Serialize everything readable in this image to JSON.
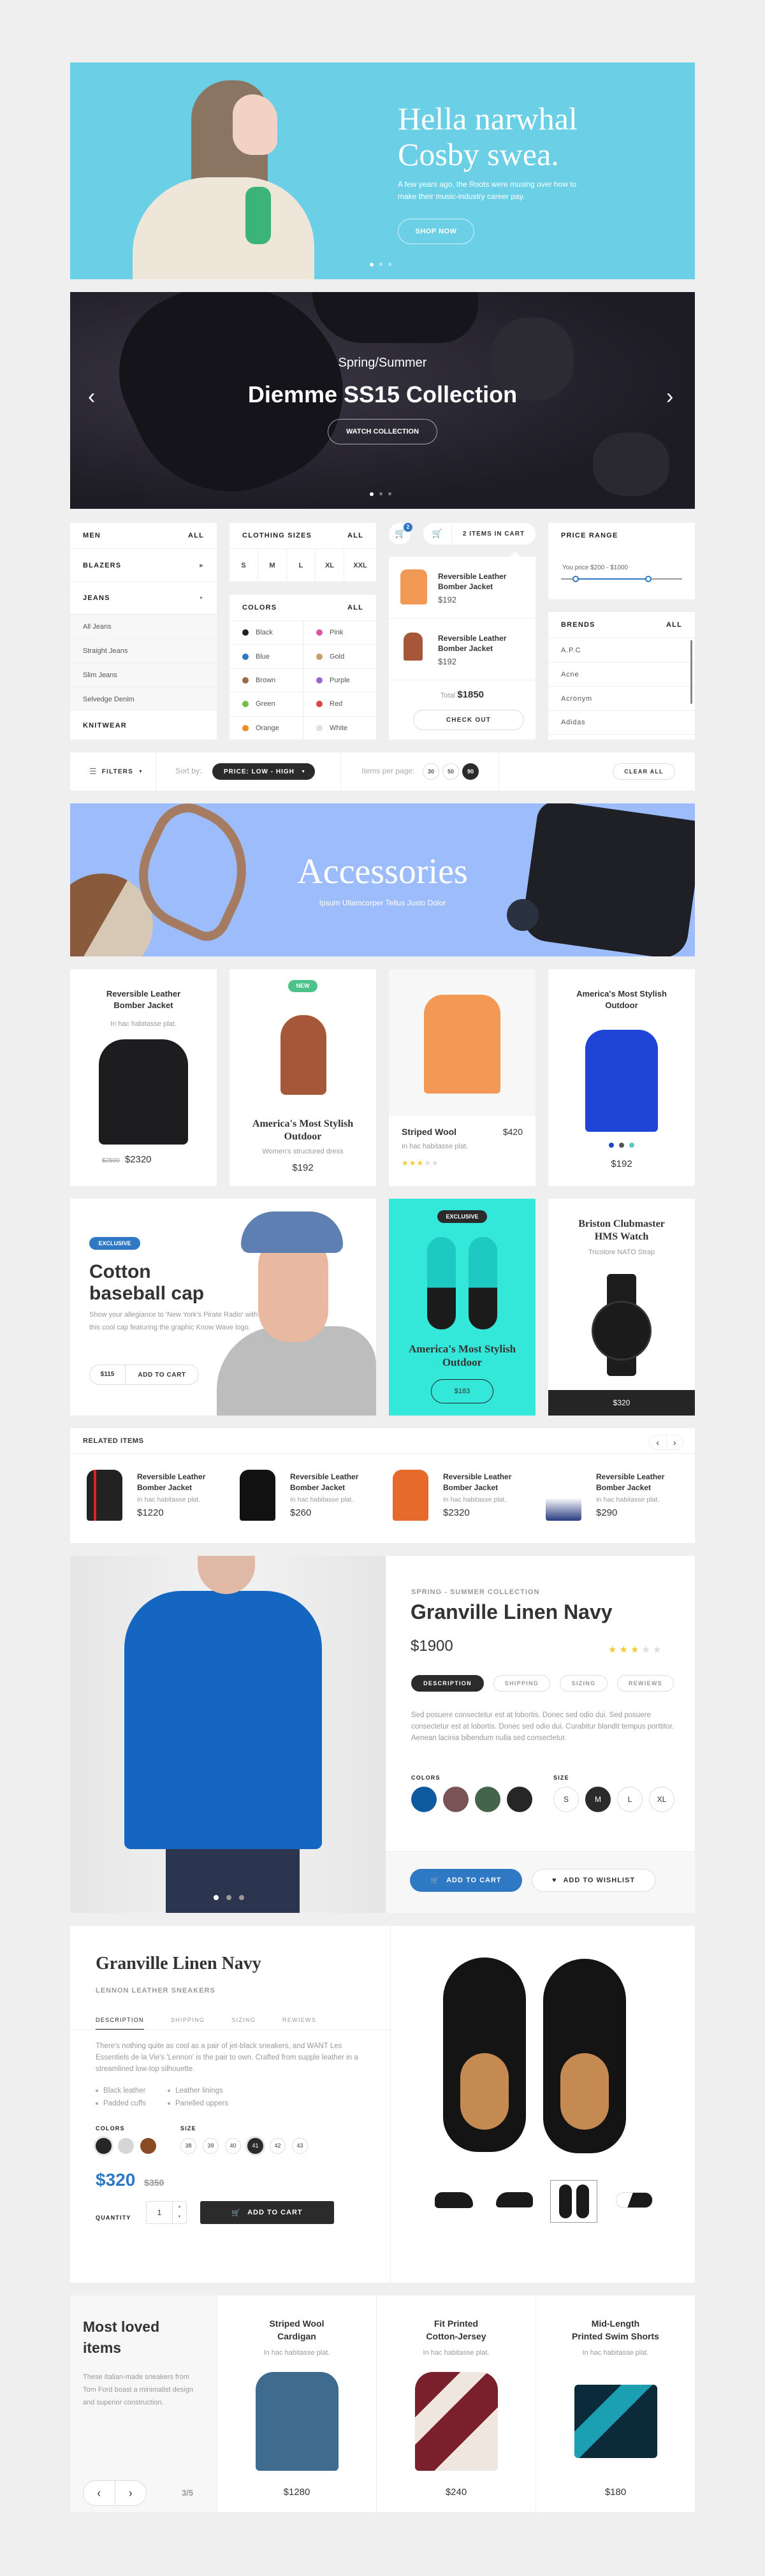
{
  "hero": {
    "title_line1": "Hella narwhal",
    "title_line2": "Cosby swea.",
    "subtitle": "A few years ago, the Roots were musing over how to make their music-industry career pay.",
    "button": "SHOP NOW",
    "bg_color": "#6bd0e6"
  },
  "hero2": {
    "kicker": "Spring/Summer",
    "title": "Diemme SS15 Collection",
    "button": "WATCH COLLECTION"
  },
  "filters": {
    "men": {
      "title": "MEN",
      "all": "ALL",
      "categories": [
        "BLAZERS",
        "JEANS",
        "KNITWEAR"
      ],
      "jeans_sub": [
        "All Jeans",
        "Straight Jeans",
        "Slim Jeans",
        "Selvedge Denim"
      ]
    },
    "sizes": {
      "title": "CLOTHING SIZES",
      "all": "ALL",
      "options": [
        "S",
        "M",
        "L",
        "XL",
        "XXL"
      ]
    },
    "colors": {
      "title": "COLORS",
      "all": "ALL",
      "options": [
        {
          "name": "Black",
          "hex": "#222222"
        },
        {
          "name": "Pink",
          "hex": "#d9579f"
        },
        {
          "name": "Blue",
          "hex": "#2f78c4"
        },
        {
          "name": "Gold",
          "hex": "#c5a06a"
        },
        {
          "name": "Brown",
          "hex": "#9a6a45"
        },
        {
          "name": "Purple",
          "hex": "#9569cf"
        },
        {
          "name": "Green",
          "hex": "#6fbf4a"
        },
        {
          "name": "Red",
          "hex": "#d9434e"
        },
        {
          "name": "Orange",
          "hex": "#ee8c25"
        },
        {
          "name": "White",
          "hex": "#dde2ea"
        }
      ]
    },
    "cart": {
      "badge": "2",
      "label": "2 ITEMS IN CART",
      "items": [
        {
          "name_line1": "Reversible Leather",
          "name_line2": "Bomber Jacket",
          "price": "$192"
        },
        {
          "name_line1": "Reversible Leather",
          "name_line2": "Bomber Jacket",
          "price": "$192"
        }
      ],
      "total_label": "Total",
      "total": "$1850",
      "checkout": "CHECK OUT"
    },
    "price_range": {
      "title": "PRICE RANGE",
      "text": "You price $200 - $1000"
    },
    "brands": {
      "title": "BRENDS",
      "all": "ALL",
      "items": [
        "A.P.C",
        "Acne",
        "Acronym",
        "Adidas"
      ]
    }
  },
  "toolbar": {
    "filters": "FILTERS",
    "sort_label": "Sort by:",
    "sort_value": "PRICE: LOW - HIGH",
    "per_page_label": "Items per page:",
    "per_page_options": [
      "30",
      "50",
      "90"
    ],
    "per_page_selected": "90",
    "clear": "CLEAR ALL"
  },
  "accessories": {
    "title": "Accessories",
    "subtitle": "Ipsum Ullamcorper Tellus Justo Dolor",
    "bg_color": "#9dbcfb"
  },
  "products": [
    {
      "title_line1": "Reversible Leather",
      "title_line2": "Bomber Jacket",
      "subtitle": "In hac habitasse plat.",
      "old_price": "$2500",
      "price": "$2320"
    },
    {
      "badge": "NEW",
      "title_line1": "America's Most Stylish",
      "title_line2": "Outdoor",
      "subtitle": "Women's structured dress",
      "price": "$192"
    },
    {
      "title": "Striped Wool",
      "price": "$420",
      "subtitle": "In hac habitasse plat.",
      "rating": 3,
      "rating_max": 5
    },
    {
      "title_line1": "America's Most Stylish",
      "title_line2": "Outdoor",
      "swatches": [
        "#2244cc",
        "#555555",
        "#5bc8c0"
      ],
      "price": "$192"
    }
  ],
  "promo": {
    "cap": {
      "badge": "EXCLUSIVE",
      "title_line1": "Cotton",
      "title_line2": "baseball cap",
      "description": "Show your allegiance to 'New York's Pirate Radio' with this cool cap featuring the graphic Know Wave logo.",
      "price": "$115",
      "button": "ADD TO CART"
    },
    "sneaker": {
      "badge": "EXCLUSIVE",
      "title_line1": "America's Most Stylish",
      "title_line2": "Outdoor",
      "price": "$183",
      "bg_color": "#34e8d9"
    },
    "watch": {
      "title_line1": "Briston Clubmaster",
      "title_line2": "HMS Watch",
      "subtitle": "Tricolore NATO Strap",
      "price": "$320"
    }
  },
  "related": {
    "title": "RELATED ITEMS",
    "items": [
      {
        "title_line1": "Reversible Leather",
        "title_line2": "Bomber Jacket",
        "subtitle": "In hac habitasse plat.",
        "price": "$1220"
      },
      {
        "title_line1": "Reversible Leather",
        "title_line2": "Bomber Jacket",
        "subtitle": "In hac habitasse plat.",
        "price": "$260"
      },
      {
        "title_line1": "Reversible Leather",
        "title_line2": "Bomber Jacket",
        "subtitle": "In hac habitasse plat.",
        "price": "$2320"
      },
      {
        "title_line1": "Reversible Leather",
        "title_line2": "Bomber Jacket",
        "subtitle": "In hac habitasse plat.",
        "price": "$290"
      }
    ]
  },
  "detail": {
    "kicker": "SPRING - SUMMER COLLECTION",
    "title": "Granville Linen Navy",
    "price": "$1900",
    "rating": 3,
    "rating_max": 5,
    "tabs": [
      "DESCRIPTION",
      "SHIPPING",
      "SIZING",
      "REWIEWS"
    ],
    "active_tab": "DESCRIPTION",
    "description": "Sed posuere consectetur est at lobortis. Donec sed odio dui. Sed posuere consectetur est at lobortis. Donec sed odio dui. Curabitur blandit tempus porttitor. Aenean lacinia bibendum nulla sed consectetur.",
    "colors_label": "COLORS",
    "colors": [
      "#0f5aa0",
      "#7a5454",
      "#44644c",
      "#262626"
    ],
    "size_label": "SIZE",
    "sizes": [
      "S",
      "M",
      "L",
      "XL"
    ],
    "selected_size": "M",
    "add_to_cart": "ADD TO CART",
    "wishlist": "ADD TO WISHLIST",
    "accent": "#2f78c4"
  },
  "sneaker_detail": {
    "title": "Granville Linen Navy",
    "subtitle": "LENNON LEATHER SNEAKERS",
    "tabs": [
      "DESCRIPTION",
      "SHIPPING",
      "SIZING",
      "REWIEWS"
    ],
    "active_tab": "DESCRIPTION",
    "description": "There's nothing quite as cool as a pair of jet-black sneakers, and WANT Les Essentiels de la Vie's 'Lennon' is the pair to own. Crafted from supple leather in a streamlined low-top silhouette.",
    "features": [
      "Black leather",
      "Leather linings",
      "Padded cuffs",
      "Panelled uppers"
    ],
    "colors_label": "COLORS",
    "colors": [
      "#262626",
      "#d6d6d6",
      "#8a4a24"
    ],
    "size_label": "SIZE",
    "sizes": [
      "38",
      "39",
      "40",
      "41",
      "42",
      "43"
    ],
    "selected_size": "41",
    "price": "$320",
    "old_price": "$350",
    "quantity_label": "QUANTITY",
    "quantity": "1",
    "add_to_cart": "ADD TO CART"
  },
  "most_loved": {
    "title_line1": "Most loved",
    "title_line2": "items",
    "description": "These Italian-made sneakers from Tom Ford boast a minimalist design and superior construction.",
    "pager": "3/5",
    "items": [
      {
        "title_line1": "Striped Wool",
        "title_line2": "Cardigan",
        "subtitle": "In hac habitasse plat.",
        "price": "$1280"
      },
      {
        "title_line1": "Fit Printed",
        "title_line2": "Cotton-Jersey",
        "subtitle": "In hac habitasse plat.",
        "price": "$240"
      },
      {
        "title_line1": "Mid-Length",
        "title_line2": "Printed Swim Shorts",
        "subtitle": "In hac habitasse plat.",
        "price": "$180"
      }
    ]
  }
}
